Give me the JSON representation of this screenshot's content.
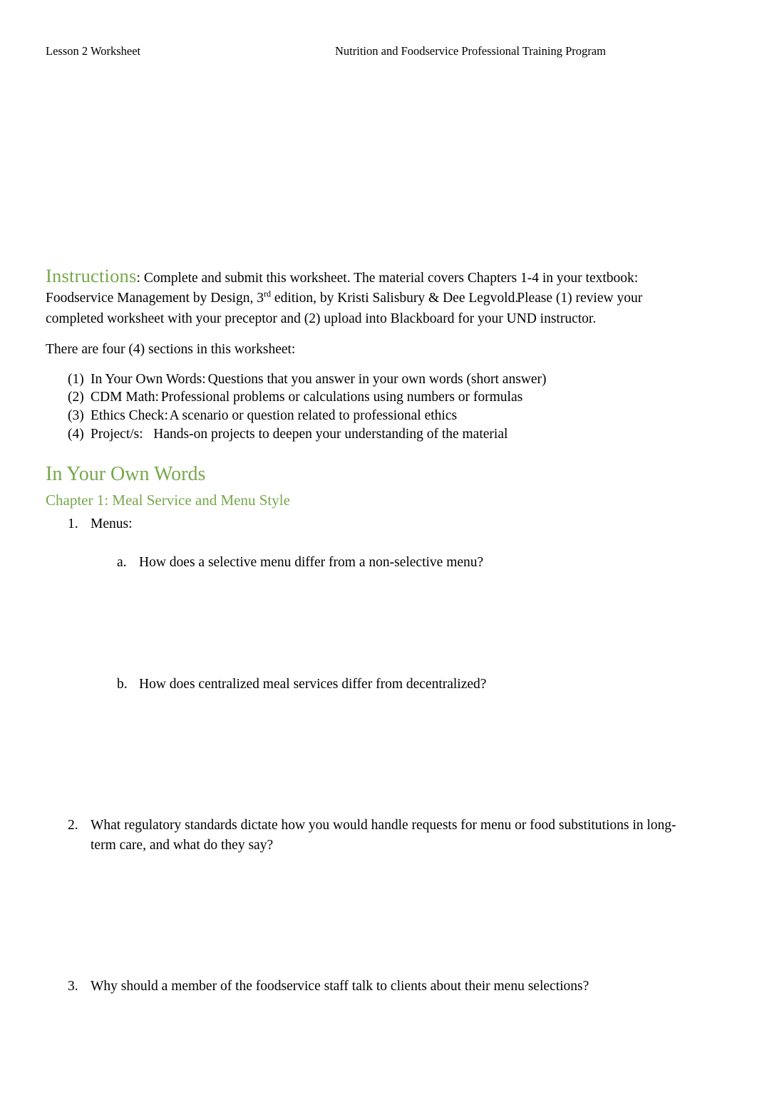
{
  "header": {
    "left": "Lesson 2 Worksheet",
    "right": "Nutrition and Foodservice Professional Training Program"
  },
  "instructions": {
    "heading": "Instructions",
    "colon": ":",
    "line_part_1": "Complete and submit this worksheet.   The material covers Chapters 1-4 in your textbook: Foodservice Management by Design, 3",
    "superscript": "rd",
    "line_part_2": " edition, by Kristi Salisbury & Dee Legvold.",
    "line_part_3": "Please (1) review your completed worksheet with your preceptor and (2) upload into Blackboard for your UND instructor."
  },
  "sections_intro": "There are four (4) sections in this worksheet:",
  "section_list": [
    {
      "marker": "(1)",
      "label": "In Your Own Words",
      "separator": ":",
      "description": " Questions that you answer in your own words (short answer)"
    },
    {
      "marker": "(2)",
      "label": "CDM Math",
      "separator": ":",
      "description": " Professional problems or calculations using numbers or formulas"
    },
    {
      "marker": "(3)",
      "label": "Ethics Check",
      "separator": ":",
      "description": " A scenario or question related to professional ethics"
    },
    {
      "marker": "(4)",
      "label": "Project/s:",
      "separator": "",
      "description": "   Hands-on projects to deepen your understanding of the material"
    }
  ],
  "in_your_own_words": {
    "heading": "In Your Own Words",
    "chapter_heading": "Chapter 1: Meal Service and Menu Style",
    "questions": [
      {
        "marker": "1.",
        "text": "Menus:",
        "sub_questions": [
          {
            "marker": "a.",
            "text": "How does a selective menu differ from a non-selective menu?"
          },
          {
            "marker": "b.",
            "text": "How does centralized meal services differ from decentralized?"
          }
        ]
      },
      {
        "marker": "2.",
        "text": "What regulatory standards dictate how you would handle requests for menu or food substitutions in long-term care, and what do they say?",
        "sub_questions": []
      },
      {
        "marker": "3.",
        "text": "Why should a member of the foodservice staff talk to clients about their menu selections?",
        "sub_questions": []
      }
    ]
  },
  "colors": {
    "accent_green": "#76A84B",
    "text": "#000000",
    "page_background": "#ffffff"
  }
}
